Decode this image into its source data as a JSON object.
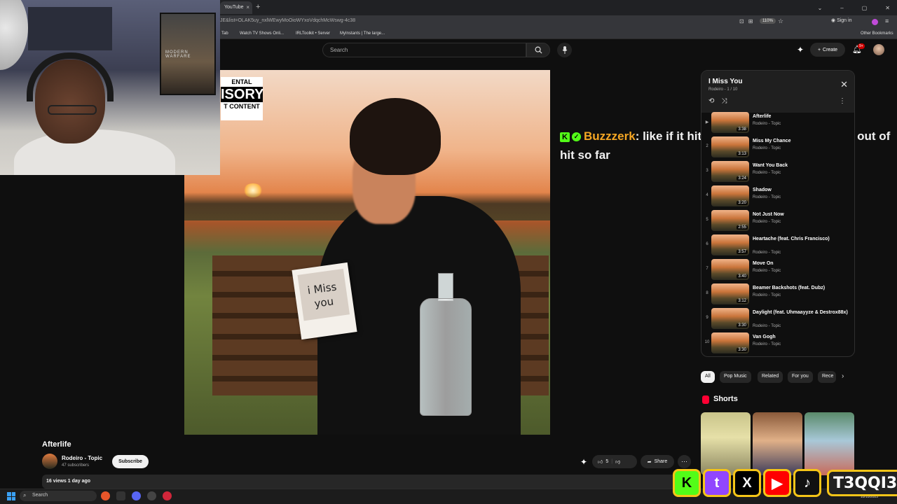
{
  "browser": {
    "tab_title": "YouTube",
    "tab_close": "×",
    "new_tab": "+",
    "url": "JE&list=OLAK5uy_nxlWEwyMoOioWYxoVdqchMcWswg-4c38",
    "zoom": "110%",
    "sign_in": "Sign in",
    "window_controls": [
      "⌄",
      "–",
      "▢",
      "✕"
    ],
    "bookmarks": [
      {
        "label": "Tab"
      },
      {
        "label": "Watch TV Shows Onli..."
      },
      {
        "label": "IRLToolkit • Server"
      },
      {
        "label": "MyInstants | The large..."
      }
    ],
    "other_bookmarks": "Other Bookmarks"
  },
  "header": {
    "search_placeholder": "Search",
    "create_label": "Create",
    "notif_badge": "9+"
  },
  "album_art": {
    "advisory_top": "ENTAL",
    "advisory_mid": "ISORY",
    "advisory_bottom": "T CONTENT",
    "card_text": "i Miss you"
  },
  "webcam": {
    "poster_text": "MODERN WARFARE"
  },
  "chat": {
    "platform_badge": "K",
    "verified": "✓",
    "username": "Buzzzerk",
    "message": ": like if it hits, like 1 song for 1 2 songs out of hit so far"
  },
  "playlist": {
    "title": "I Miss You",
    "subtitle": "Rodeiro - 1 / 10",
    "close": "✕",
    "items": [
      {
        "num": "▶",
        "title": "Afterlife",
        "artist": "Rodeiro - Topic",
        "duration": "3:38"
      },
      {
        "num": "2",
        "title": "Miss My Chance",
        "artist": "Rodeiro - Topic",
        "duration": "3:13"
      },
      {
        "num": "3",
        "title": "Want You Back",
        "artist": "Rodeiro - Topic",
        "duration": "3:24"
      },
      {
        "num": "4",
        "title": "Shadow",
        "artist": "Rodeiro - Topic",
        "duration": "3:20"
      },
      {
        "num": "5",
        "title": "Not Just Now",
        "artist": "Rodeiro - Topic",
        "duration": "2:55"
      },
      {
        "num": "6",
        "title": "Heartache (feat. Chris Francisco)",
        "artist": "Rodeiro - Topic",
        "duration": "3:57"
      },
      {
        "num": "7",
        "title": "Move On",
        "artist": "Rodeiro - Topic",
        "duration": "3:40"
      },
      {
        "num": "8",
        "title": "Beamer Backshots (feat. Dubz)",
        "artist": "Rodeiro - Topic",
        "duration": "3:12"
      },
      {
        "num": "9",
        "title": "Daylight (feat. Uhmaayyze & Destrox88x)",
        "artist": "Rodeiro - Topic",
        "duration": "3:30"
      },
      {
        "num": "10",
        "title": "Van Gogh",
        "artist": "Rodeiro - Topic",
        "duration": "3:30"
      }
    ]
  },
  "chips": [
    "All",
    "Pop Music",
    "Related",
    "For you",
    "Rece"
  ],
  "shorts": {
    "label": "Shorts"
  },
  "video": {
    "title": "Afterlife",
    "channel": "Rodeiro - Topic",
    "subscribers": "47 subscribers",
    "subscribe": "Subscribe",
    "likes": "5",
    "share": "Share",
    "description": "16 views  1 day ago"
  },
  "taskbar": {
    "search": "Search",
    "date": "10/10/2025"
  },
  "socials": {
    "kick": "K",
    "twitch": "t",
    "x": "X",
    "youtube": "▶",
    "tiktok": "♪",
    "handle": "T3QQI3"
  },
  "colors": {
    "kick_green": "#53fc18",
    "username_orange": "#f5a623",
    "social_border": "#f5c518"
  }
}
